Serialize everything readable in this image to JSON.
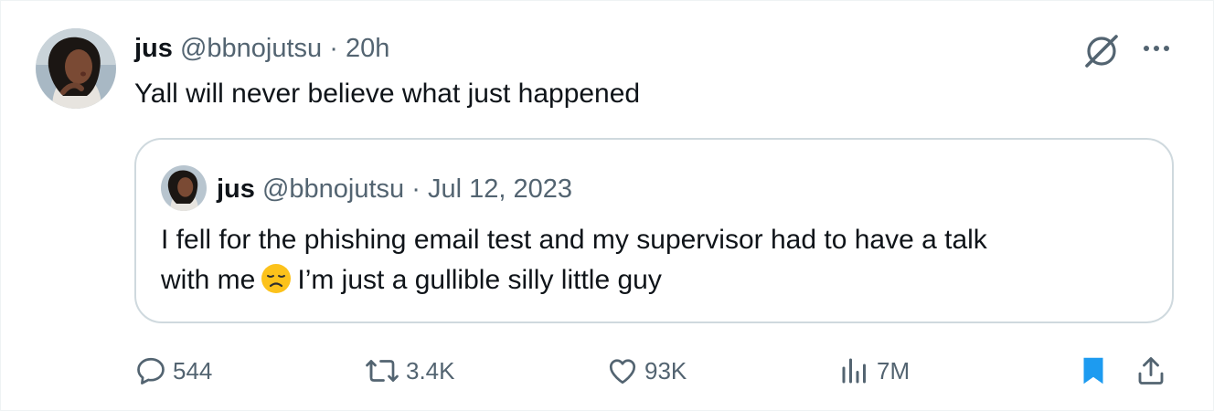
{
  "tweet": {
    "author_name": "jus",
    "handle": "@bbnojutsu",
    "separator": "·",
    "time": "20h",
    "text": "Yall will never believe what just happened"
  },
  "quote": {
    "author_name": "jus",
    "handle": "@bbnojutsu",
    "separator": "·",
    "date": "Jul 12, 2023",
    "text_line1": "I fell for the phishing email test and my supervisor had to have a talk",
    "text_line2_before": "with me",
    "text_line2_after": "I’m just a gullible silly little guy",
    "emoji": "disappointed-face"
  },
  "actions": {
    "replies": "544",
    "reposts": "3.4K",
    "likes": "93K",
    "views": "7M"
  },
  "colors": {
    "text": "#0f1419",
    "muted": "#536471",
    "border": "#cfd9de",
    "bookmark_active": "#1d9bf0"
  },
  "icons": {
    "grok": "grok-icon",
    "more": "more-icon",
    "reply": "reply-icon",
    "repost": "repost-icon",
    "like": "heart-icon",
    "views": "views-icon",
    "bookmark": "bookmark-icon",
    "share": "share-icon"
  }
}
